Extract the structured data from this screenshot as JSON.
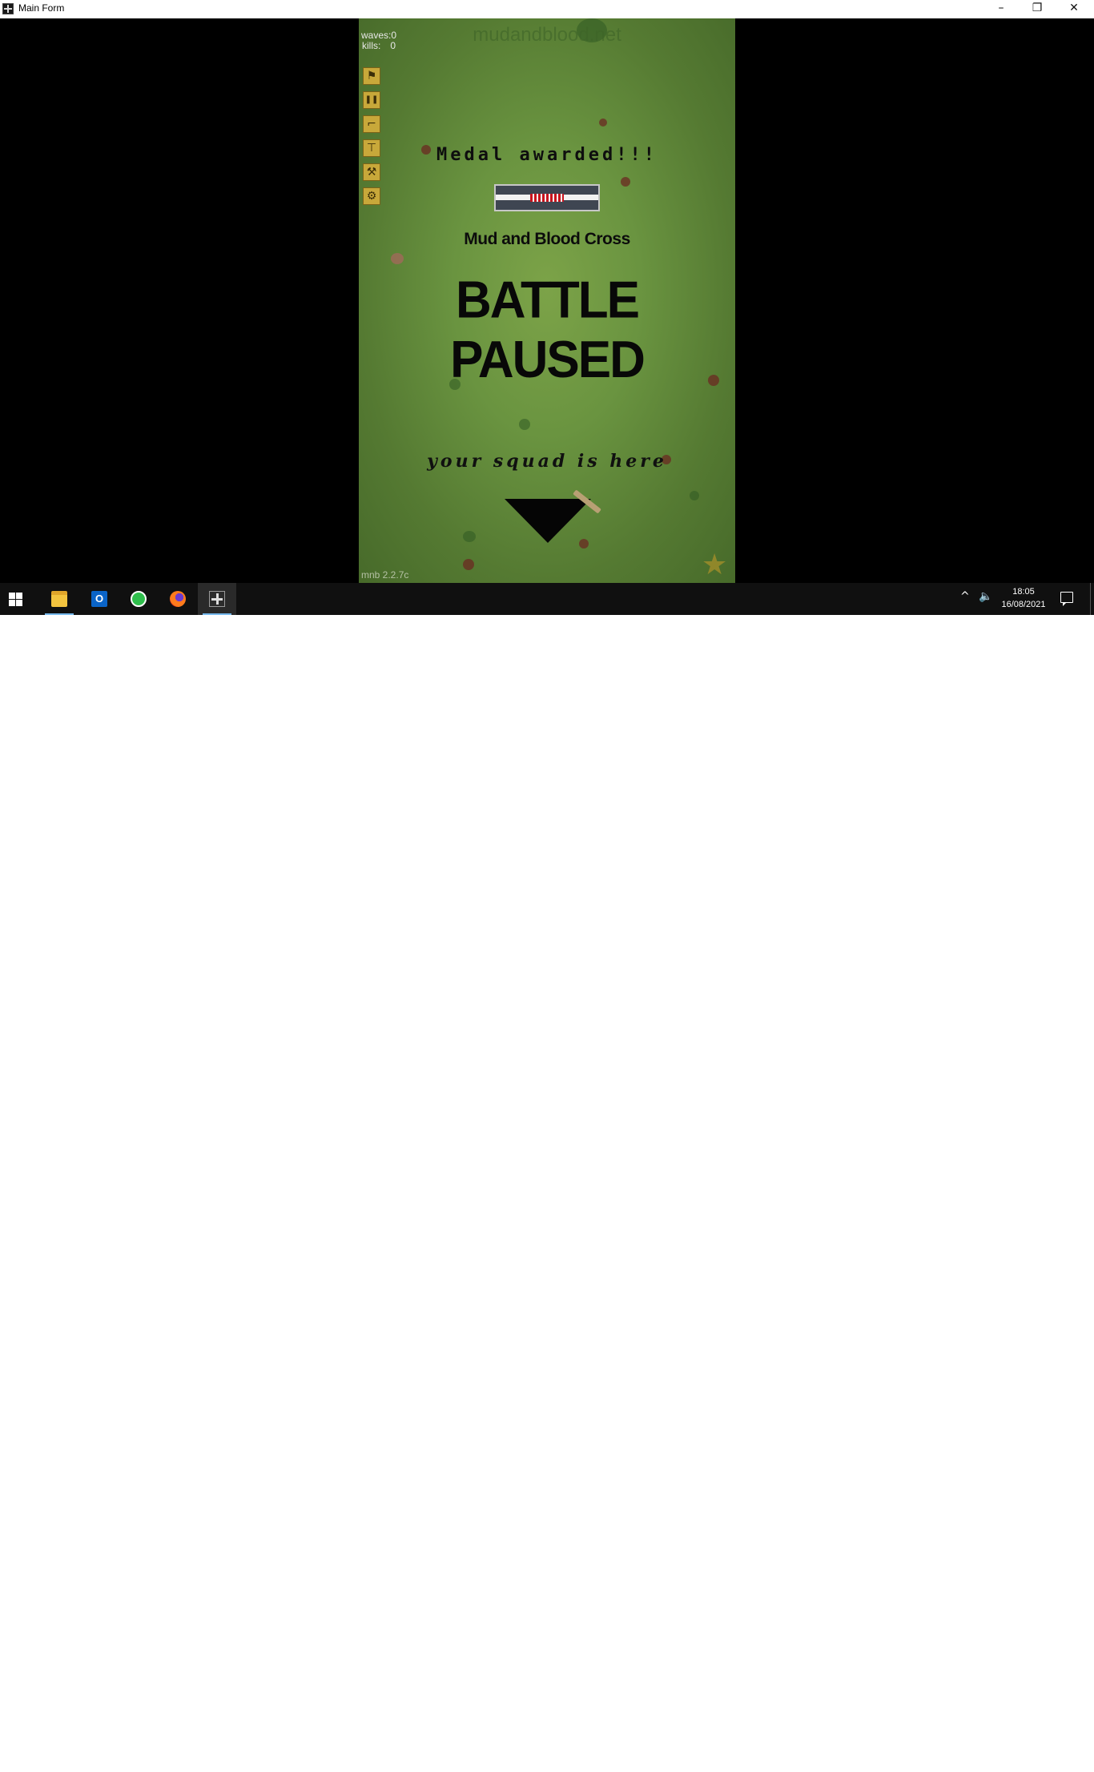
{
  "window": {
    "title": "Main Form",
    "minimize_icon": "–",
    "maximize_icon": "❐",
    "close_icon": "✕"
  },
  "game": {
    "watermark": "mudandblood.net",
    "stats": {
      "waves_label": "waves:",
      "waves_value": "0",
      "kills_label": "kills:",
      "kills_value": "0"
    },
    "side_buttons": [
      {
        "icon": "soldier-icon",
        "glyph": "⚑"
      },
      {
        "icon": "pause-icon",
        "glyph": "❚❚"
      },
      {
        "icon": "rifle-icon",
        "glyph": "⌐"
      },
      {
        "icon": "tower-icon",
        "glyph": "⊤"
      },
      {
        "icon": "wrench-icon",
        "glyph": "⚒"
      },
      {
        "icon": "gears-icon",
        "glyph": "⚙"
      }
    ],
    "medal_title": "Medal awarded!!!",
    "medal_name": "Mud and Blood Cross",
    "paused_text": "BATTLE PAUSED",
    "squad_text": "your squad is here",
    "version": "mnb 2.2.7c",
    "rank_glyph": "★"
  },
  "taskbar": {
    "apps": [
      {
        "name": "file-explorer",
        "active": false,
        "underline": true
      },
      {
        "name": "outlook",
        "active": false,
        "underline": false,
        "glyph": "O"
      },
      {
        "name": "whatsapp",
        "active": false,
        "underline": false
      },
      {
        "name": "firefox",
        "active": false,
        "underline": false
      },
      {
        "name": "mud-and-blood",
        "active": true,
        "underline": true
      }
    ],
    "tray_up_glyph": "^",
    "volume_glyph": "🔈",
    "time": "18:05",
    "date": "16/08/2021"
  },
  "colors": {
    "grass": "#6a9440",
    "ribbon_blue": "#3f4652",
    "ribbon_red": "#c8141e",
    "taskbar": "#101010",
    "accent": "#76b9ed"
  }
}
